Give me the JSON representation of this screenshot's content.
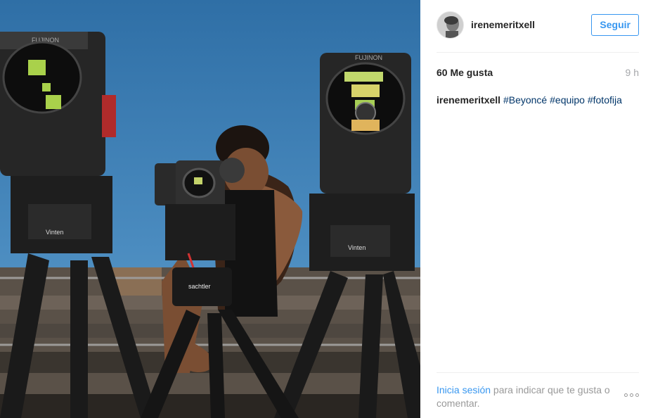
{
  "post": {
    "username": "irenemeritxell",
    "follow_label": "Seguir",
    "likes": "60 Me gusta",
    "time_ago": "9 h",
    "caption_user": "irenemeritxell",
    "hashtags": [
      "#Beyoncé",
      "#equipo",
      "#fotofija"
    ],
    "photo_camera_brands": [
      "FUJINON",
      "Vinten",
      "sachtler"
    ]
  },
  "footer": {
    "login_link": "Inicia sesión",
    "login_text": " para indicar que te gusta o comentar."
  },
  "colors": {
    "accent": "#3897f0",
    "hashtag": "#003569",
    "muted": "#a5a7aa"
  },
  "icons": {
    "more": "more-options-icon"
  }
}
